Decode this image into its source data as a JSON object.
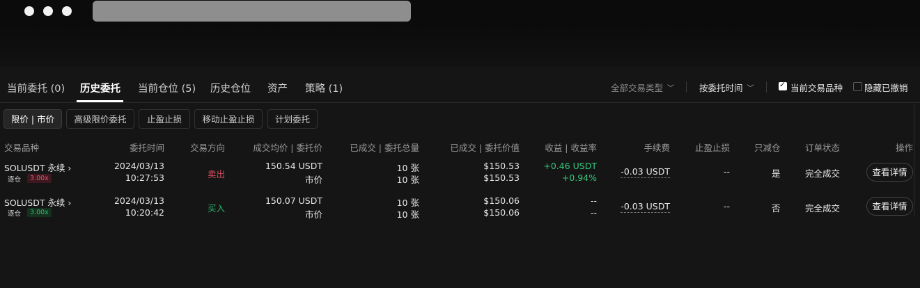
{
  "main_tabs": [
    {
      "label": "当前委托 (0)"
    },
    {
      "label": "历史委托"
    },
    {
      "label": "当前仓位 (5)"
    },
    {
      "label": "历史仓位"
    },
    {
      "label": "资产"
    },
    {
      "label": "策略 (1)"
    }
  ],
  "filters": {
    "trade_type": "全部交易类型",
    "sort_by": "按委托时间",
    "current_symbol_label": "当前交易品种",
    "current_symbol_checked": true,
    "hide_cancelled_label": "隐藏已撤销",
    "hide_cancelled_checked": false
  },
  "sub_tabs": [
    {
      "label": "限价 | 市价"
    },
    {
      "label": "高级限价委托"
    },
    {
      "label": "止盈止损"
    },
    {
      "label": "移动止盈止损"
    },
    {
      "label": "计划委托"
    }
  ],
  "table": {
    "headers": [
      "交易品种",
      "委托时间",
      "交易方向",
      "成交均价 | 委托价",
      "已成交 | 委托总量",
      "已成交 | 委托价值",
      "收益 | 收益率",
      "手续费",
      "止盈止损",
      "只减仓",
      "订单状态",
      "操作"
    ],
    "rows": [
      {
        "symbol": "SOLUSDT 永续",
        "margin_mode": "逐仓",
        "leverage": "3.00x",
        "date": "2024/03/13",
        "time": "10:27:53",
        "side": "卖出",
        "avg_price": "150.54 USDT",
        "order_price": "市价",
        "filled_qty": "10 张",
        "total_qty": "10 张",
        "filled_value": "$150.53",
        "total_value": "$150.53",
        "pnl": "+0.46 USDT",
        "pnl_rate": "+0.94%",
        "fee": "-0.03 USDT",
        "tp_sl": "--",
        "reduce_only": "是",
        "status": "完全成交",
        "action": "查看详情"
      },
      {
        "symbol": "SOLUSDT 永续",
        "margin_mode": "逐仓",
        "leverage": "3.00x",
        "date": "2024/03/13",
        "time": "10:20:42",
        "side": "买入",
        "avg_price": "150.07 USDT",
        "order_price": "市价",
        "filled_qty": "10 张",
        "total_qty": "10 张",
        "filled_value": "$150.06",
        "total_value": "$150.06",
        "pnl": "--",
        "pnl_rate": "--",
        "fee": "-0.03 USDT",
        "tp_sl": "--",
        "reduce_only": "否",
        "status": "完全成交",
        "action": "查看详情"
      }
    ]
  },
  "colors": {
    "sell": "#d84a5f",
    "buy": "#29b36b",
    "profit": "#37c77a",
    "background": "#151515"
  }
}
